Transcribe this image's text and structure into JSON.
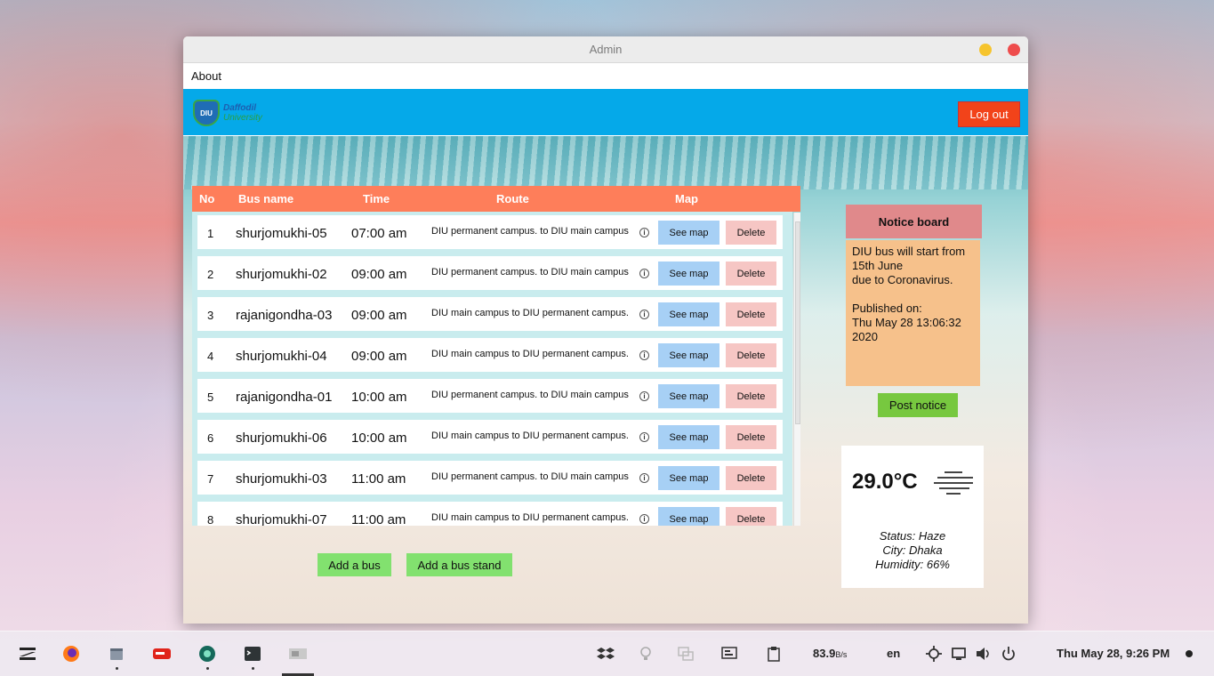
{
  "window": {
    "title": "Admin",
    "menu": [
      "About"
    ],
    "logo": {
      "line1": "Daffodil",
      "line2": "University",
      "badge": "DIU"
    },
    "logout_label": "Log out"
  },
  "table": {
    "headers": {
      "no": "No",
      "name": "Bus name",
      "time": "Time",
      "route": "Route",
      "map": "Map"
    },
    "rows": [
      {
        "no": "1",
        "name": "shurjomukhi-05",
        "time": "07:00 am",
        "route": "DIU permanent campus. to DIU main campus"
      },
      {
        "no": "2",
        "name": "shurjomukhi-02",
        "time": "09:00 am",
        "route": "DIU permanent campus. to DIU main campus"
      },
      {
        "no": "3",
        "name": "rajanigondha-03",
        "time": "09:00 am",
        "route": "DIU main campus to DIU permanent campus."
      },
      {
        "no": "4",
        "name": "shurjomukhi-04",
        "time": "09:00 am",
        "route": "DIU main campus to DIU permanent campus."
      },
      {
        "no": "5",
        "name": "rajanigondha-01",
        "time": "10:00 am",
        "route": "DIU permanent campus. to DIU main campus"
      },
      {
        "no": "6",
        "name": "shurjomukhi-06",
        "time": "10:00 am",
        "route": "DIU main campus to DIU permanent campus."
      },
      {
        "no": "7",
        "name": "shurjomukhi-03",
        "time": "11:00 am",
        "route": "DIU permanent campus. to DIU main campus"
      },
      {
        "no": "8",
        "name": "shurjomukhi-07",
        "time": "11:00 am",
        "route": "DIU main campus to DIU permanent campus."
      }
    ],
    "see_map_label": "See map",
    "delete_label": "Delete",
    "info_glyph": "i"
  },
  "actions": {
    "add_bus": "Add a bus",
    "add_stand": "Add a bus stand"
  },
  "notice": {
    "title": "Notice board",
    "lines": [
      "DIU bus will start from",
      "15th June",
      "due to Coronavirus.",
      "",
      "Published on:",
      "Thu May 28 13:06:32",
      "2020"
    ],
    "post_label": "Post notice"
  },
  "weather": {
    "temp": "29.0°C",
    "icon": "haze-icon",
    "status": "Status: Haze",
    "city": "City: Dhaka",
    "humidity": "Humidity: 66%"
  },
  "taskbar": {
    "apps": [
      "zorin-menu-icon",
      "firefox-icon",
      "files-icon",
      "redshift-icon",
      "app-icon",
      "terminal-icon",
      "window-icon"
    ],
    "net_speed": "83.9",
    "net_unit": "B/s",
    "lang": "en",
    "clock": "Thu May 28,  9:26 PM"
  },
  "colors": {
    "topbar": "#05a9e9",
    "logout": "#f2431a",
    "table_header": "#fe7e5a",
    "see_map": "#a7d0f5",
    "delete": "#f6c6c4",
    "green_button": "#82e16f",
    "notice_head": "#e0898b",
    "notice_body": "#f6c18b"
  }
}
